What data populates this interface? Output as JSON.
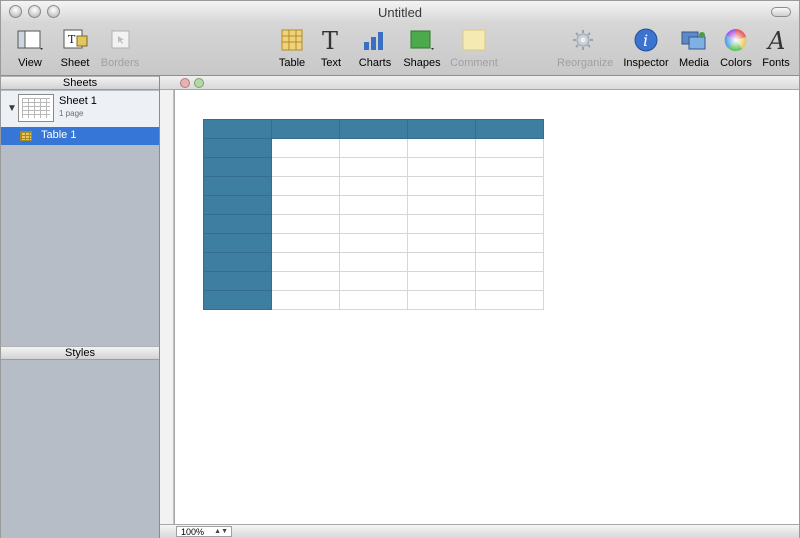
{
  "window": {
    "title": "Untitled"
  },
  "toolbar": {
    "items": [
      {
        "label": "View"
      },
      {
        "label": "Sheet"
      },
      {
        "label": "Borders"
      },
      {
        "label": "Table"
      },
      {
        "label": "Text"
      },
      {
        "label": "Charts"
      },
      {
        "label": "Shapes"
      },
      {
        "label": "Comment"
      },
      {
        "label": "Reorganize"
      },
      {
        "label": "Inspector"
      },
      {
        "label": "Media"
      },
      {
        "label": "Colors"
      },
      {
        "label": "Fonts"
      }
    ]
  },
  "sidebar": {
    "sheets_header": "Sheets",
    "sheet": {
      "name": "Sheet 1",
      "subtitle": "1 page"
    },
    "table": {
      "name": "Table 1"
    },
    "styles_header": "Styles"
  },
  "status": {
    "zoom": "100%"
  },
  "colors": {
    "table_header": "#3e7ea1",
    "selection": "#3576d6"
  },
  "table_grid": {
    "rows": 10,
    "columns": 5,
    "header_rows": 1,
    "header_columns": 1
  }
}
